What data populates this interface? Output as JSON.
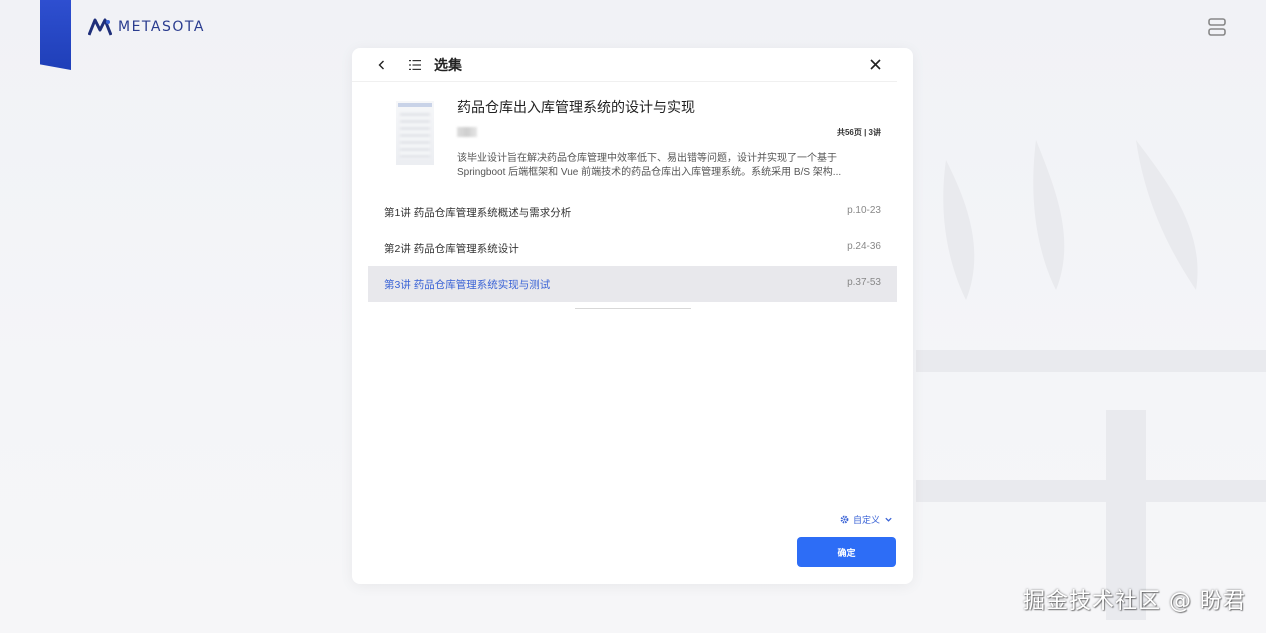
{
  "brand": {
    "name": "METASOTA"
  },
  "modal": {
    "title": "选集",
    "book": {
      "title": "药品仓库出入库管理系统的设计与实现",
      "pages_info": "共56页 | 3讲",
      "description": "该毕业设计旨在解决药品仓库管理中效率低下、易出错等问题，设计并实现了一个基于Springboot 后端框架和 Vue 前端技术的药品仓库出入库管理系统。系统采用 B/S 架构..."
    },
    "chapters": [
      {
        "label": "第1讲 药品仓库管理系统概述与需求分析",
        "pages": "p.10-23",
        "active": false
      },
      {
        "label": "第2讲 药品仓库管理系统设计",
        "pages": "p.24-36",
        "active": false
      },
      {
        "label": "第3讲 药品仓库管理系统实现与测试",
        "pages": "p.37-53",
        "active": true
      }
    ],
    "customize_label": "自定义",
    "confirm_label": "确定"
  },
  "watermark": "掘金技术社区 @ 盼君",
  "colors": {
    "accent": "#2d6df6",
    "active_text": "#3a63d6",
    "brand": "#1f3fb8"
  },
  "icons": [
    "logo-mark-icon",
    "menu-icon",
    "chevron-left-icon",
    "list-icon",
    "close-icon",
    "gear-icon",
    "chevron-down-icon"
  ]
}
